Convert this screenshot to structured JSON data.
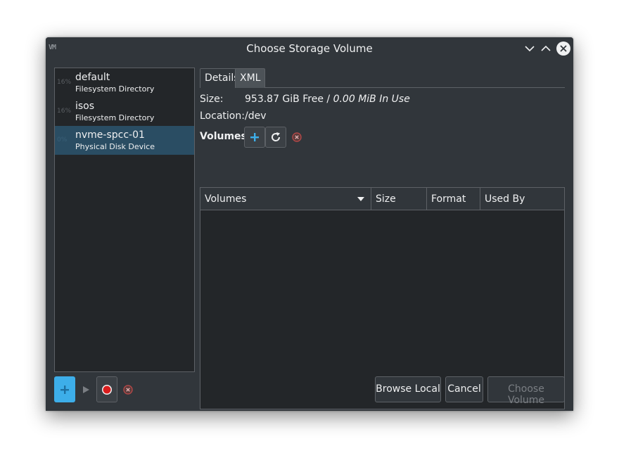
{
  "window": {
    "title": "Choose Storage Volume",
    "app_logo": "VM"
  },
  "pools": [
    {
      "usage": "16%",
      "name": "default",
      "type": "Filesystem Directory",
      "selected": false
    },
    {
      "usage": "16%",
      "name": "isos",
      "type": "Filesystem Directory",
      "selected": false
    },
    {
      "usage": "0%",
      "name": "nvme-spcc-01",
      "type": "Physical Disk Device",
      "selected": true
    }
  ],
  "tabs": [
    {
      "label": "Details",
      "active": true
    },
    {
      "label": "XML",
      "active": false
    }
  ],
  "details": {
    "size_label": "Size:",
    "size_free": "953.87 GiB Free",
    "size_sep": " / ",
    "size_in_use": "0.00 MiB In Use",
    "location_label": "Location:",
    "location_value": "/dev"
  },
  "volumes": {
    "header": "Volumes",
    "columns": [
      "Volumes",
      "Size",
      "Format",
      "Used By"
    ],
    "rows": []
  },
  "buttons": {
    "browse_local": "Browse Local",
    "cancel": "Cancel",
    "choose_volume": "Choose Volume"
  },
  "colors": {
    "accent": "#3daee9",
    "selection": "#2a4d63",
    "stop_red": "#da1d1d",
    "bg": "#31363b",
    "view_bg": "#232629"
  }
}
